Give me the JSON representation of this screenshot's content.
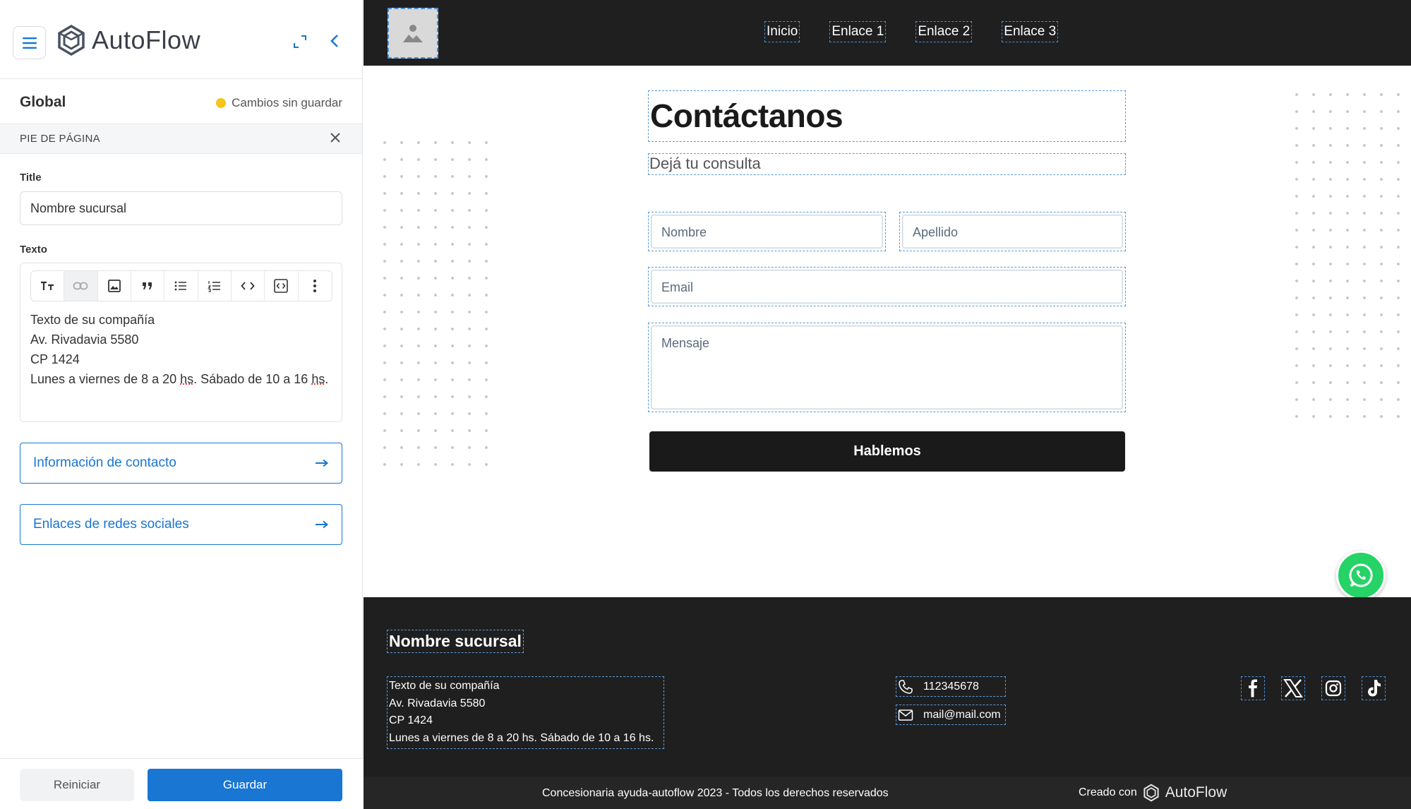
{
  "sidebar": {
    "app_name": "AutoFlow",
    "global_title": "Global",
    "unsaved_label": "Cambios sin guardar",
    "section_title": "PIE DE PÁGINA",
    "title_field": {
      "label": "Title",
      "value": "Nombre sucursal"
    },
    "text_field": {
      "label": "Texto",
      "lines": [
        "Texto de su compañía",
        "Av. Rivadavia 5580",
        "CP 1424",
        "Lunes a viernes de 8 a 20 ",
        "hs",
        ". Sábado de 10 a 16 ",
        "hs",
        "."
      ]
    },
    "links": [
      {
        "label": "Información de contacto"
      },
      {
        "label": "Enlaces de redes sociales"
      }
    ],
    "reset_label": "Reiniciar",
    "save_label": "Guardar",
    "colors": {
      "accent": "#1976d2",
      "unsaved_dot": "#f5c518"
    }
  },
  "preview": {
    "nav": [
      "Inicio",
      "Enlace 1",
      "Enlace 2",
      "Enlace 3"
    ],
    "title": "Contáctanos",
    "subtitle": "Dejá tu consulta",
    "form": {
      "first_name_placeholder": "Nombre",
      "last_name_placeholder": "Apellido",
      "email_placeholder": "Email",
      "message_placeholder": "Mensaje",
      "submit_label": "Hablemos"
    },
    "footer": {
      "title": "Nombre sucursal",
      "lines": [
        "Texto de su compañía",
        "Av. Rivadavia 5580",
        "CP 1424",
        "Lunes a viernes de 8 a 20 hs. Sábado de 10 a 16 hs."
      ],
      "phone": "112345678",
      "email": "mail@mail.com",
      "social_icons": [
        "facebook-icon",
        "x-icon",
        "instagram-icon",
        "tiktok-icon"
      ],
      "copyright": "Concesionaria ayuda-autoflow 2023 - Todos los derechos reservados",
      "created_with": "Creado con",
      "created_brand": "AutoFlow"
    },
    "colors": {
      "dark": "#1f1f1f",
      "whatsapp": "#25d366",
      "dashed_outline": "#5b9bd5"
    }
  }
}
